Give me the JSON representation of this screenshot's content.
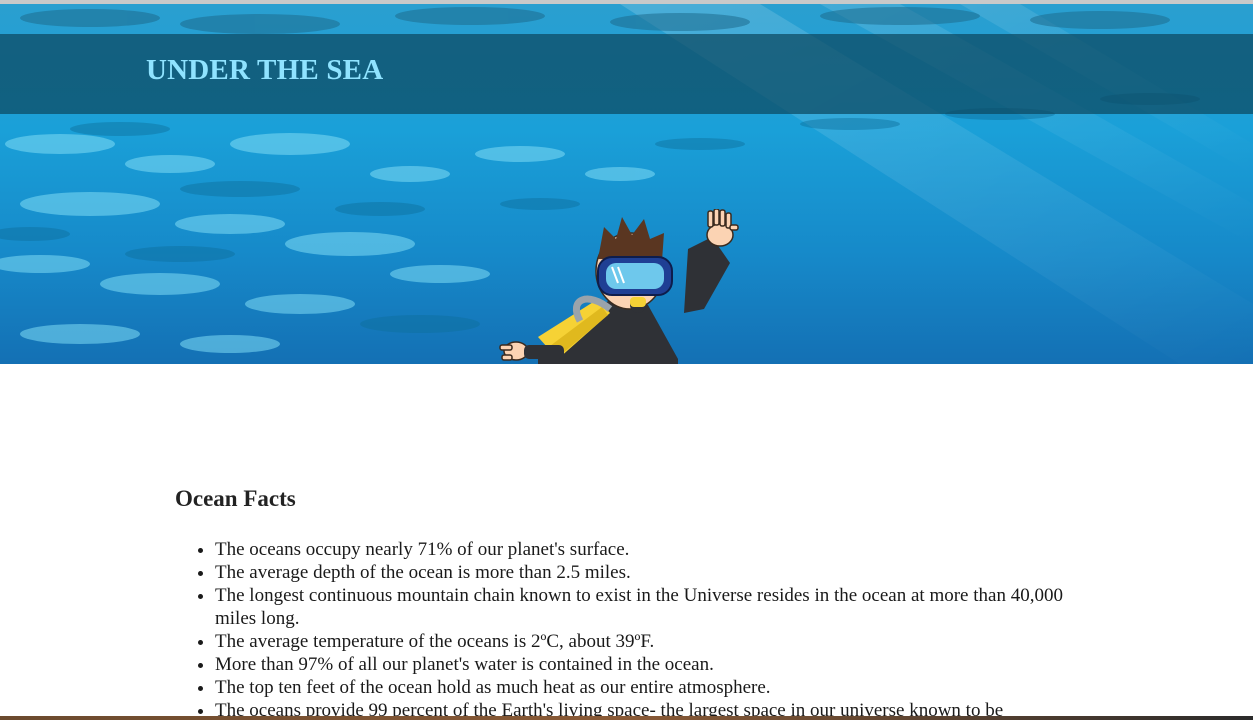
{
  "header": {
    "title": "UNDER THE SEA"
  },
  "hero": {
    "image": "ocean-diver-illustration"
  },
  "facts": {
    "heading": "Ocean Facts",
    "items": [
      "The oceans occupy nearly 71% of our planet's surface.",
      "The average depth of the ocean is more than 2.5 miles.",
      "The longest continuous mountain chain known to exist in the Universe resides in the ocean at more than 40,000 miles long.",
      "The average temperature of the oceans is 2ºC, about 39ºF.",
      "More than 97% of all our planet's water is contained in the ocean.",
      "The top ten feet of the ocean hold as much heat as our entire atmosphere.",
      "The oceans provide 99 percent of the Earth's living space- the largest space in our universe known to be"
    ]
  },
  "colors": {
    "title": "#8fe3ff",
    "title_bar": "#0c4860",
    "water": "#1aa0d8"
  }
}
